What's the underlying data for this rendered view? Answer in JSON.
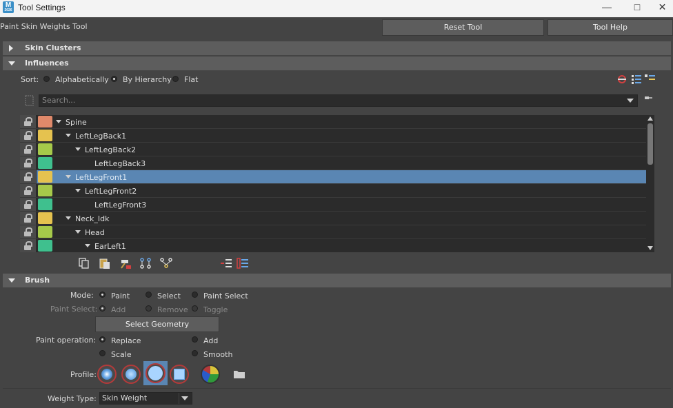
{
  "window": {
    "title": "Tool Settings",
    "app_icon_letter": "M",
    "app_icon_sub": "2026"
  },
  "header": {
    "tool_name": "Paint Skin Weights Tool",
    "reset_label": "Reset Tool",
    "help_label": "Tool Help"
  },
  "sections": {
    "skin_clusters": "Skin Clusters",
    "influences": "Influences",
    "brush": "Brush"
  },
  "influences": {
    "sort_label": "Sort:",
    "sort_options": [
      "Alphabetically",
      "By Hierarchy",
      "Flat"
    ],
    "sort_selected": "By Hierarchy",
    "search_placeholder": "Search...",
    "rows": [
      {
        "name": "Spine",
        "color": "#e0896a",
        "expanded": true,
        "selected": false
      },
      {
        "name": "LeftLegBack1",
        "color": "#e5c24f",
        "expanded": true,
        "selected": false
      },
      {
        "name": "LeftLegBack2",
        "color": "#a6c94a",
        "expanded": true,
        "selected": false
      },
      {
        "name": "LeftLegBack3",
        "color": "#3fc08e",
        "expanded": false,
        "selected": false
      },
      {
        "name": "LeftLegFront1",
        "color": "#e5c24f",
        "expanded": true,
        "selected": true
      },
      {
        "name": "LeftLegFront2",
        "color": "#a6c94a",
        "expanded": true,
        "selected": false
      },
      {
        "name": "LeftLegFront3",
        "color": "#3fc08e",
        "expanded": false,
        "selected": false
      },
      {
        "name": "Neck_Idk",
        "color": "#e5c24f",
        "expanded": true,
        "selected": false
      },
      {
        "name": "Head",
        "color": "#a6c94a",
        "expanded": true,
        "selected": false
      },
      {
        "name": "EarLeft1",
        "color": "#3fc08e",
        "expanded": true,
        "selected": false
      }
    ]
  },
  "brush": {
    "mode_label": "Mode:",
    "mode_options": [
      "Paint",
      "Select",
      "Paint Select"
    ],
    "mode_selected": "Paint",
    "paint_select_label": "Paint Select:",
    "paint_select_options": [
      "Add",
      "Remove",
      "Toggle"
    ],
    "paint_select_selected": "Add",
    "select_geometry_label": "Select Geometry",
    "paint_op_label": "Paint operation:",
    "paint_op_options": [
      "Replace",
      "Add",
      "Scale",
      "Smooth"
    ],
    "paint_op_selected": "Replace",
    "profile_label": "Profile:",
    "profile_selected_index": 2,
    "weight_type_label": "Weight Type:",
    "weight_type_value": "Skin Weight"
  }
}
